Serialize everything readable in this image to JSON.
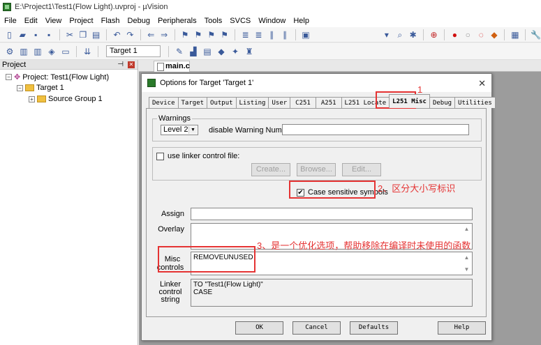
{
  "window": {
    "title": "E:\\Project1\\Test1(Flow Light).uvproj - µVision"
  },
  "menu": [
    "File",
    "Edit",
    "View",
    "Project",
    "Flash",
    "Debug",
    "Peripherals",
    "Tools",
    "SVCS",
    "Window",
    "Help"
  ],
  "toolbar2": {
    "target_combo": "Target 1"
  },
  "project_panel": {
    "title": "Project",
    "project": "Project: Test1(Flow Light)",
    "target": "Target 1",
    "group": "Source Group 1"
  },
  "editor": {
    "tab": "main.c"
  },
  "dialog": {
    "title": "Options for Target 'Target 1'",
    "tabs": [
      "Device",
      "Target",
      "Output",
      "Listing",
      "User",
      "C251",
      "A251",
      "L251 Locate",
      "L251 Misc",
      "Debug",
      "Utilities"
    ],
    "active_tab": "L251 Misc",
    "warnings": {
      "label": "Warnings",
      "level": "Level 2",
      "disable_label": "disable Warning Numbers:",
      "disable_value": ""
    },
    "linker_control": {
      "checkbox_label": "use linker control file:",
      "checked": false,
      "create": "Create...",
      "browse": "Browse...",
      "edit": "Edit..."
    },
    "case_sensitive": {
      "label": "Case sensitive symbols",
      "checked": true,
      "check_glyph": "✔"
    },
    "assign_label": "Assign",
    "assign_value": "",
    "overlay_label": "Overlay",
    "overlay_value": "",
    "misc_label_1": "Misc",
    "misc_label_2": "controls",
    "misc_value": "REMOVEUNUSED",
    "linker_label_1": "Linker",
    "linker_label_2": "control",
    "linker_label_3": "string",
    "linker_value": "TO \"Test1(Flow Light)\"\nCASE",
    "buttons": {
      "ok": "OK",
      "cancel": "Cancel",
      "defaults": "Defaults",
      "help": "Help"
    }
  },
  "annotations": {
    "a1": "1",
    "a2": "2、区分大小写标识",
    "a3": "3、是一个优化选项，帮助移除在编译时未使用的函数"
  },
  "colors": {
    "annotation": "#e53333",
    "dialog_bg": "#f0f0f0",
    "editor_bg": "#9c9c9c"
  }
}
